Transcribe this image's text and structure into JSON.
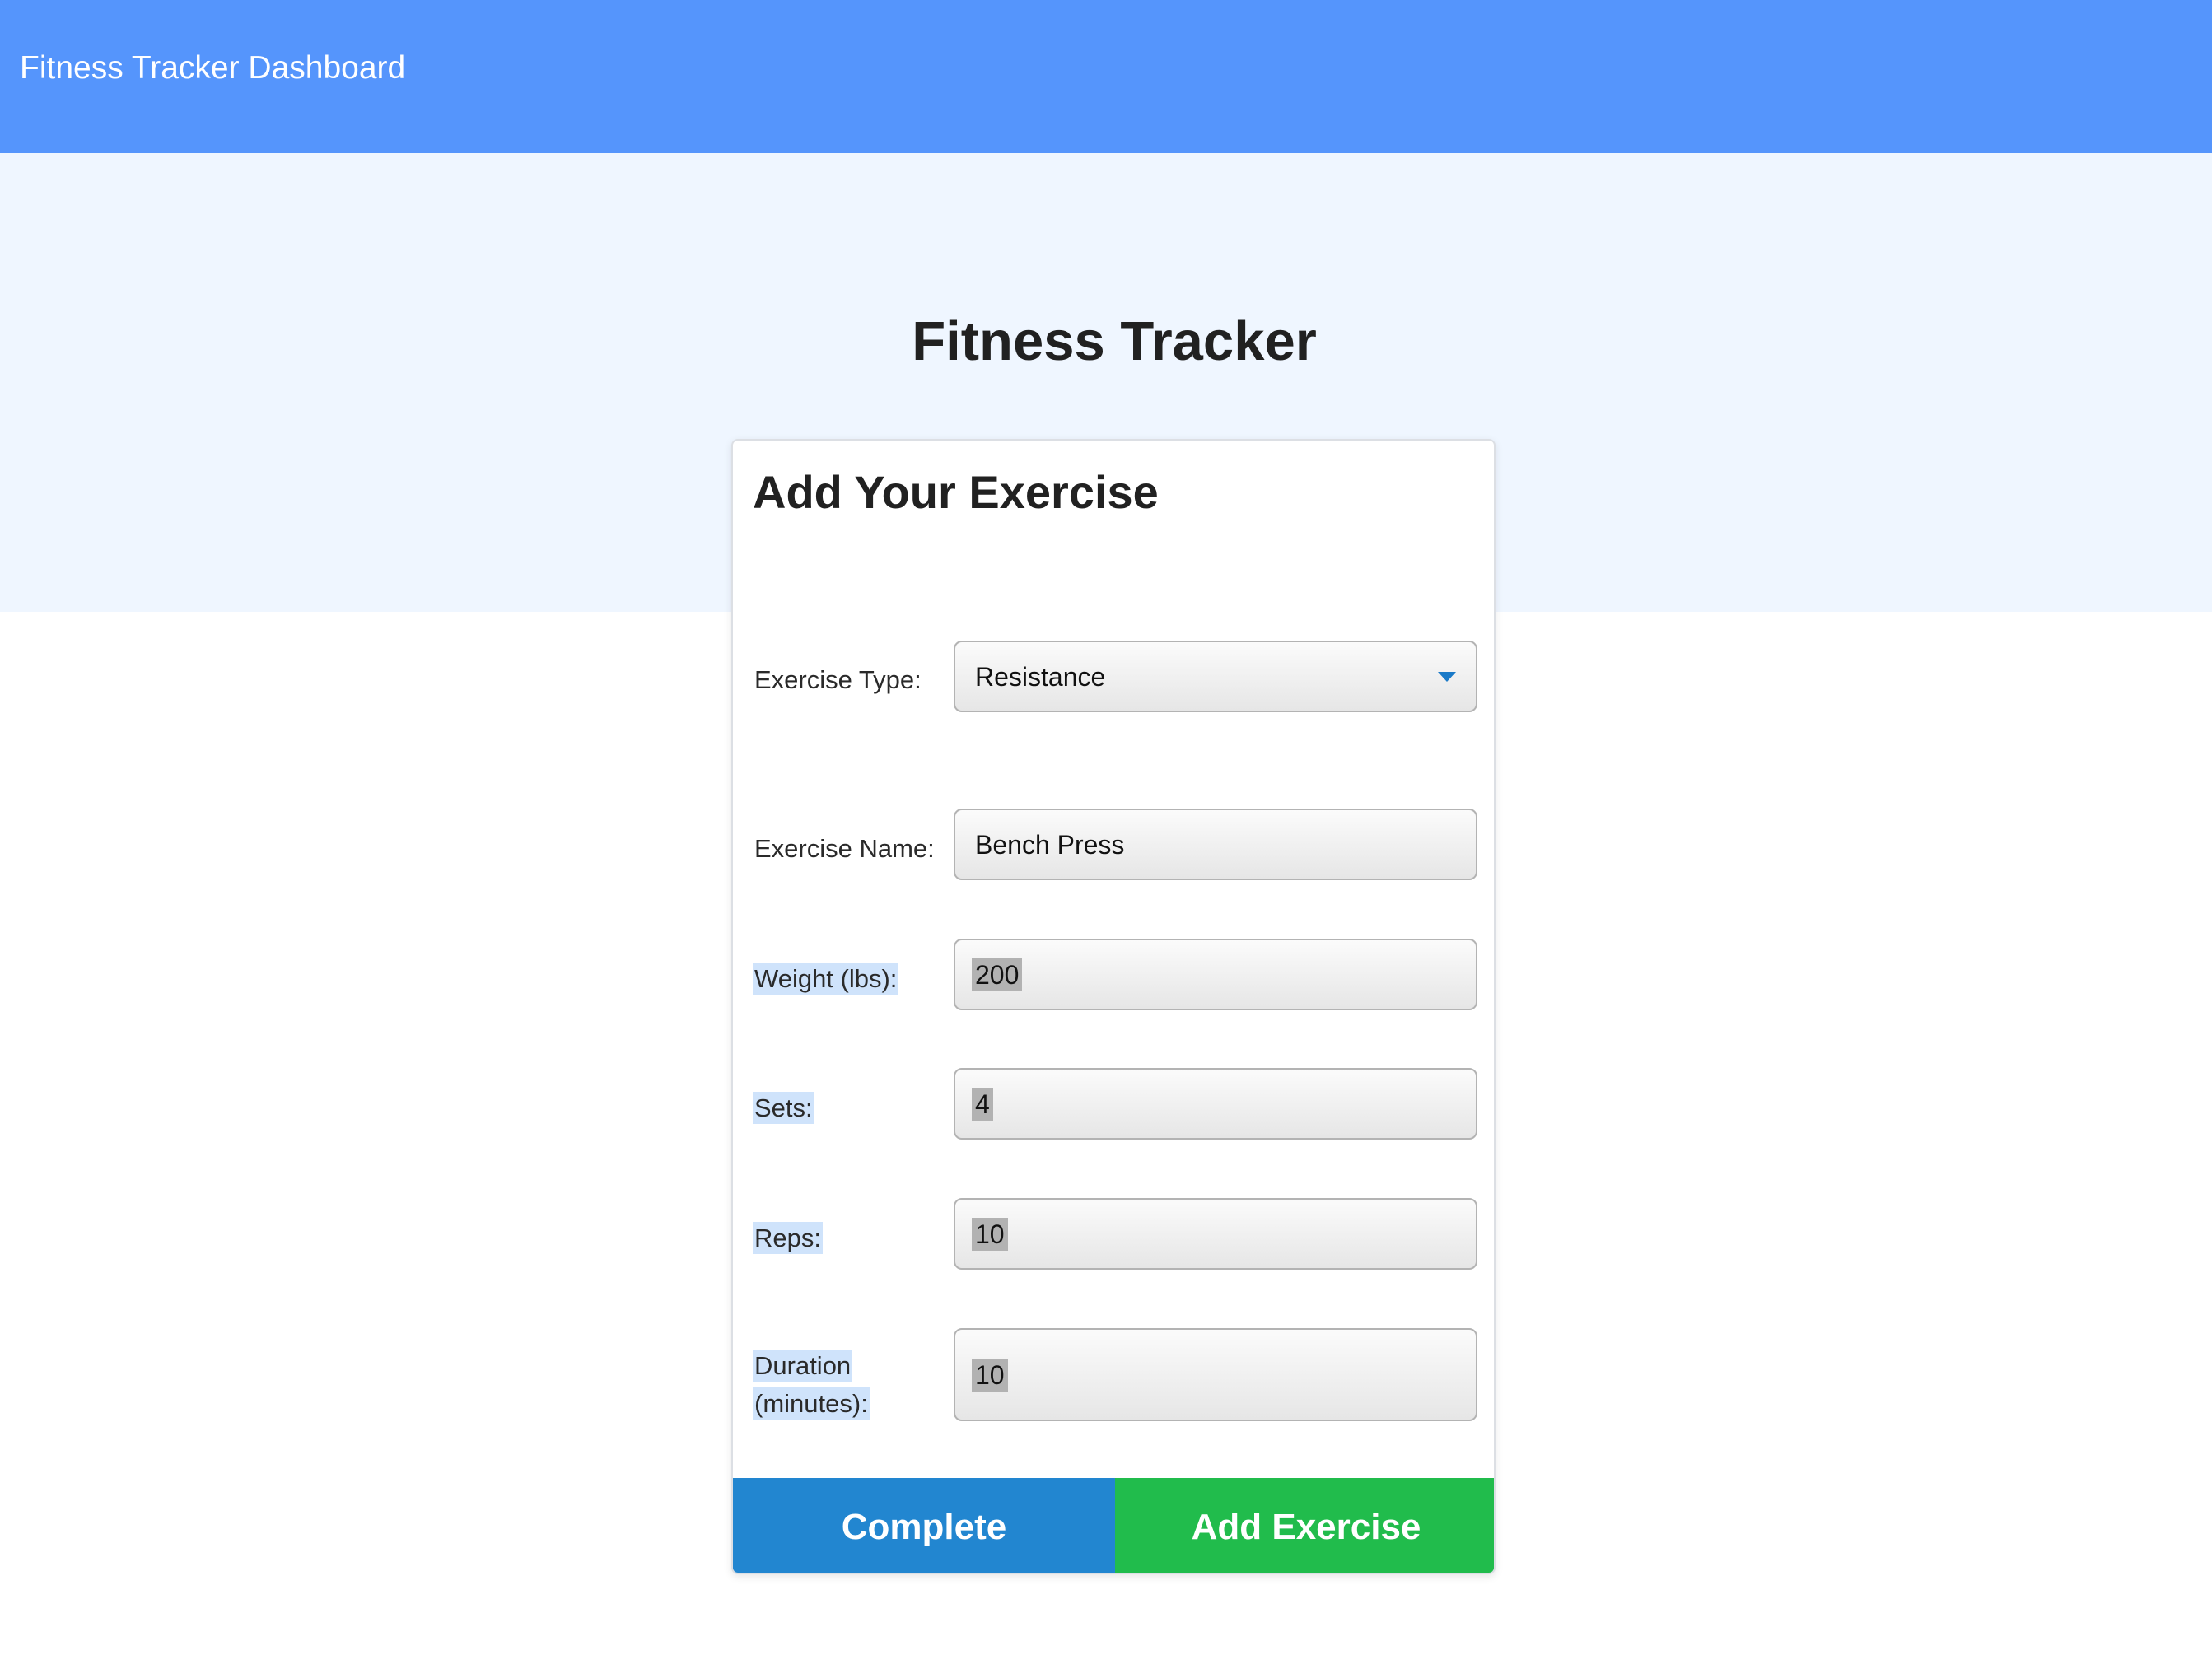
{
  "navbar": {
    "title": "Fitness Tracker Dashboard"
  },
  "page": {
    "title": "Fitness Tracker"
  },
  "form": {
    "title": "Add Your Exercise",
    "exercise_type": {
      "label": "Exercise Type:",
      "value": "Resistance"
    },
    "exercise_name": {
      "label": "Exercise Name:",
      "value": "Bench Press"
    },
    "weight": {
      "label": "Weight (lbs):",
      "value": "200"
    },
    "sets": {
      "label": "Sets:",
      "value": "4"
    },
    "reps": {
      "label": "Reps:",
      "value": "10"
    },
    "duration": {
      "label_line1": "Duration",
      "label_line2": "(minutes):",
      "value": "10"
    }
  },
  "buttons": {
    "complete": "Complete",
    "add_exercise": "Add Exercise"
  },
  "colors": {
    "navbar": "#5595fc",
    "hero": "#eff6ff",
    "complete": "#2286d0",
    "add_exercise": "#21bc4c",
    "dropdown_arrow": "#1a7ac8",
    "selection_highlight": "#cfe3fb"
  }
}
